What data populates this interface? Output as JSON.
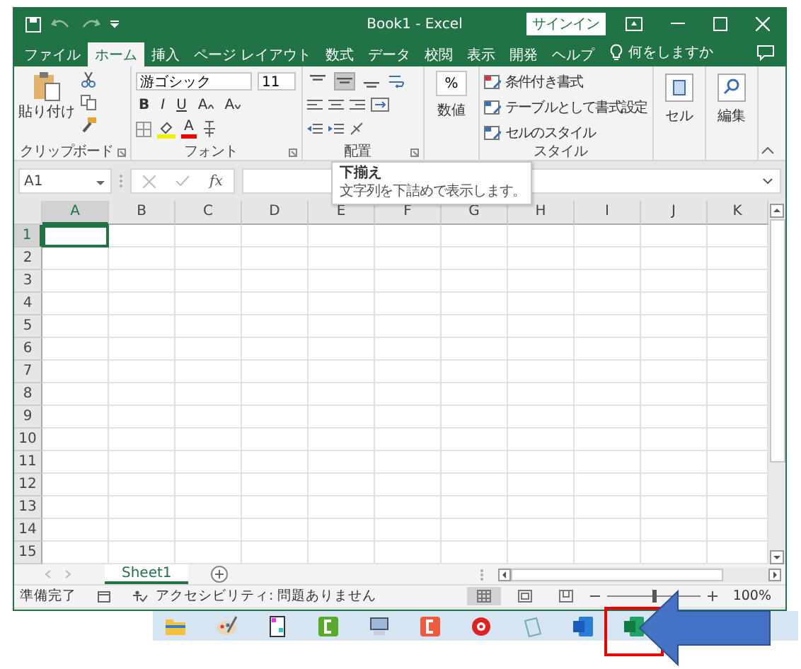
{
  "window": {
    "title": "Book1  -  Excel",
    "signin": "サインイン"
  },
  "ribbon_tabs": [
    {
      "label": "ファイル",
      "selected": false
    },
    {
      "label": "ホーム",
      "selected": true
    },
    {
      "label": "挿入",
      "selected": false
    },
    {
      "label": "ページ レイアウト",
      "selected": false
    },
    {
      "label": "数式",
      "selected": false
    },
    {
      "label": "データ",
      "selected": false
    },
    {
      "label": "校閲",
      "selected": false
    },
    {
      "label": "表示",
      "selected": false
    },
    {
      "label": "開発",
      "selected": false
    },
    {
      "label": "ヘルプ",
      "selected": false
    }
  ],
  "tell_me": "何をしますか",
  "clipboard": {
    "paste": "貼り付け",
    "label": "クリップボード"
  },
  "font": {
    "name": "游ゴシック",
    "size": "11",
    "bold": "B",
    "italic": "I",
    "underline": "U",
    "grow": "A",
    "shrink": "A",
    "color_letter": "A",
    "label": "フォント"
  },
  "alignment": {
    "vertical": [
      {
        "selected": false
      },
      {
        "selected": true
      },
      {
        "selected": false
      }
    ],
    "label": "配置"
  },
  "number": {
    "symbol": "%",
    "label": "数値"
  },
  "styles": {
    "items": [
      "条件付き書式",
      "テーブルとして書式設定",
      "セルのスタイル"
    ],
    "label": "スタイル"
  },
  "cells": {
    "label": "セル"
  },
  "editing": {
    "label": "編集"
  },
  "tooltip": {
    "title": "下揃え",
    "text": "文字列を下詰めで表示します。"
  },
  "formula_bar": {
    "name_box": "A1",
    "fx": "fx"
  },
  "columns": [
    {
      "label": "A",
      "selected": true
    },
    {
      "label": "B",
      "selected": false
    },
    {
      "label": "C",
      "selected": false
    },
    {
      "label": "D",
      "selected": false
    },
    {
      "label": "E",
      "selected": false
    },
    {
      "label": "F",
      "selected": false
    },
    {
      "label": "G",
      "selected": false
    },
    {
      "label": "H",
      "selected": false
    },
    {
      "label": "I",
      "selected": false
    },
    {
      "label": "J",
      "selected": false
    },
    {
      "label": "K",
      "selected": false
    }
  ],
  "rows": [
    {
      "label": "1",
      "selected": true
    },
    {
      "label": "2",
      "selected": false
    },
    {
      "label": "3",
      "selected": false
    },
    {
      "label": "4",
      "selected": false
    },
    {
      "label": "5",
      "selected": false
    },
    {
      "label": "6",
      "selected": false
    },
    {
      "label": "7",
      "selected": false
    },
    {
      "label": "8",
      "selected": false
    },
    {
      "label": "9",
      "selected": false
    },
    {
      "label": "10",
      "selected": false
    },
    {
      "label": "11",
      "selected": false
    },
    {
      "label": "12",
      "selected": false
    },
    {
      "label": "13",
      "selected": false
    },
    {
      "label": "14",
      "selected": false
    },
    {
      "label": "15",
      "selected": false
    }
  ],
  "sheet_tabs": [
    {
      "label": "Sheet1",
      "selected": true
    }
  ],
  "status_bar": {
    "ready": "準備完了",
    "accessibility": "アクセシビリティ: 問題ありません",
    "views": [
      {
        "selected": true
      },
      {
        "selected": false
      },
      {
        "selected": false
      }
    ],
    "zoom": {
      "level": 0.5,
      "reading": "100%"
    }
  },
  "taskbar": [
    {
      "kind": "folder",
      "marked": false
    },
    {
      "kind": "palette",
      "marked": false
    },
    {
      "kind": "document",
      "marked": false
    },
    {
      "kind": "app-green",
      "marked": false
    },
    {
      "kind": "computer",
      "marked": false
    },
    {
      "kind": "app-red",
      "marked": false
    },
    {
      "kind": "disc",
      "marked": false
    },
    {
      "kind": "notepad",
      "marked": false
    },
    {
      "kind": "word",
      "marked": false
    },
    {
      "kind": "excel",
      "marked": true
    }
  ]
}
